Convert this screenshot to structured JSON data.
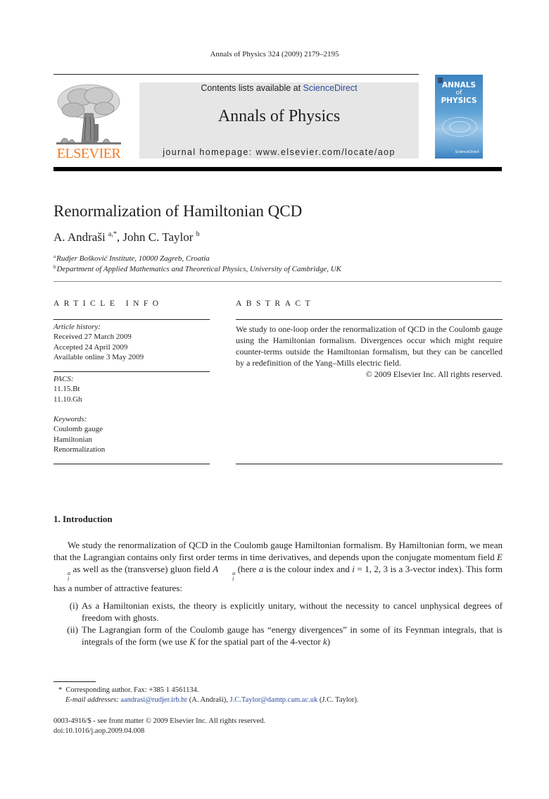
{
  "header": {
    "citation": "Annals of Physics 324 (2009) 2179–2195",
    "contents_prefix": "Contents lists available at ",
    "contents_link": "ScienceDirect",
    "journal_title": "Annals of Physics",
    "homepage": "journal homepage: www.elsevier.com/locate/aop",
    "publisher_logo": "ELSEVIER",
    "cover": {
      "title_line1": "ANNALS",
      "title_line2": "of",
      "title_line3": "PHYSICS",
      "publisher": "ScienceDirect"
    },
    "accent_colors": {
      "elsevier_orange": "#f47a20",
      "link_blue": "#2b4a9a",
      "banner_grey": "#e6e6e6",
      "cover_blue": "#4a8fca"
    }
  },
  "article": {
    "title": "Renormalization of Hamiltonian QCD",
    "authors": [
      {
        "name": "A. Andraši",
        "marks": "a,*"
      },
      {
        "name": "John C. Taylor",
        "marks": "b"
      }
    ],
    "author_separator": ", ",
    "affiliations": [
      {
        "mark": "a",
        "text": "Rudjer Bošković Institute, 10000 Zagreb, Croatia"
      },
      {
        "mark": "b",
        "text": "Department of Applied Mathematics and Theoretical Physics, University of Cambridge, UK"
      }
    ]
  },
  "article_info": {
    "heading": "ARTICLE INFO",
    "history_label": "Article history:",
    "history": [
      "Received 27 March 2009",
      "Accepted 24 April 2009",
      "Available online 3 May 2009"
    ],
    "pacs_label": "PACS:",
    "pacs": [
      "11.15.Bt",
      "11.10.Gh"
    ],
    "keywords_label": "Keywords:",
    "keywords": [
      "Coulomb gauge",
      "Hamiltonian",
      "Renormalization"
    ]
  },
  "abstract": {
    "heading": "ABSTRACT",
    "text": "We study to one-loop order the renormalization of QCD in the Coulomb gauge using the Hamiltonian formalism. Divergences occur which might require counter-terms outside the Hamiltonian formalism, but they can be cancelled by a redefinition of the Yang–Mills electric field.",
    "copyright": "© 2009 Elsevier Inc. All rights reserved."
  },
  "introduction": {
    "heading": "1. Introduction",
    "p1_part1": "We study the renormalization of QCD in the Coulomb gauge Hamiltonian formalism. By Hamiltonian form, we mean that the Lagrangian contains only first order terms in time derivatives, and depends upon the conjugate momentum field ",
    "p1_E": "E",
    "p1_E_sup": "a",
    "p1_E_sub": "i",
    "p1_part2": " as well as the (transverse) gluon field ",
    "p1_A": "A",
    "p1_A_sup": "a",
    "p1_A_sub": "i",
    "p1_part3": " (here ",
    "p1_a": "a",
    "p1_part4": " is the colour index and ",
    "p1_i": "i",
    "p1_part5": " = 1, 2, 3 is a 3-vector index). This form has a number of attractive features:",
    "items": [
      {
        "num": "(i)",
        "text": "As a Hamiltonian exists, the theory is explicitly unitary, without the necessity to cancel unphysical degrees of freedom with ghosts."
      },
      {
        "num": "(ii)",
        "text_part1": "The Lagrangian form of the Coulomb gauge has “energy divergences” in some of its Feynman integrals, that is integrals of the form (we use ",
        "K": "K",
        "text_part2": " for the spatial part of the 4-vector ",
        "k": "k",
        "text_part3": ")"
      }
    ]
  },
  "footnotes": {
    "corresponding": "Corresponding author. Fax: +385 1 4561134.",
    "corresponding_mark": "*",
    "email_label": "E-mail addresses:",
    "email1": "aandrasi@rudjer.irb.hr",
    "email1_owner": " (A. Andraši), ",
    "email2": "J.C.Taylor@damtp.cam.ac.uk",
    "email2_owner": " (J.C. Taylor)."
  },
  "front_matter": {
    "issn_line": "0003-4916/$ - see front matter © 2009 Elsevier Inc. All rights reserved.",
    "doi": "doi:10.1016/j.aop.2009.04.008"
  }
}
